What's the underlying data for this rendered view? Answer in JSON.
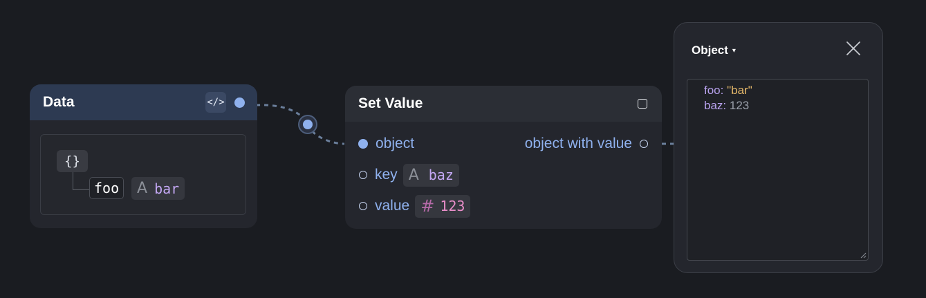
{
  "data_node": {
    "title": "Data",
    "code_toggle_glyph": "</>",
    "brace_glyph": "{}",
    "entry": {
      "key": "foo",
      "type_glyph": "A",
      "value": "bar"
    }
  },
  "setvalue_node": {
    "title": "Set Value",
    "inputs": {
      "object": {
        "label": "object"
      },
      "key": {
        "label": "key",
        "type_glyph": "A",
        "value": "baz"
      },
      "value": {
        "label": "value",
        "type_glyph": "#",
        "value": "123"
      }
    },
    "output": {
      "label": "object with value"
    }
  },
  "object_panel": {
    "title": "Object",
    "caret": "▾",
    "json": {
      "line1_key": "foo:",
      "line1_value": "\"bar\"",
      "line2_key": "baz:",
      "line2_value": "123"
    }
  },
  "colors": {
    "background": "#1a1c21",
    "node": "#24262d",
    "data_header": "#2d3a52",
    "port": "#8fb1ee",
    "string": "#c4a8f5",
    "number": "#e98ec9"
  },
  "icons": [
    "code-icon",
    "square-icon",
    "close-icon",
    "caret-down-icon",
    "resize-grip-icon"
  ]
}
